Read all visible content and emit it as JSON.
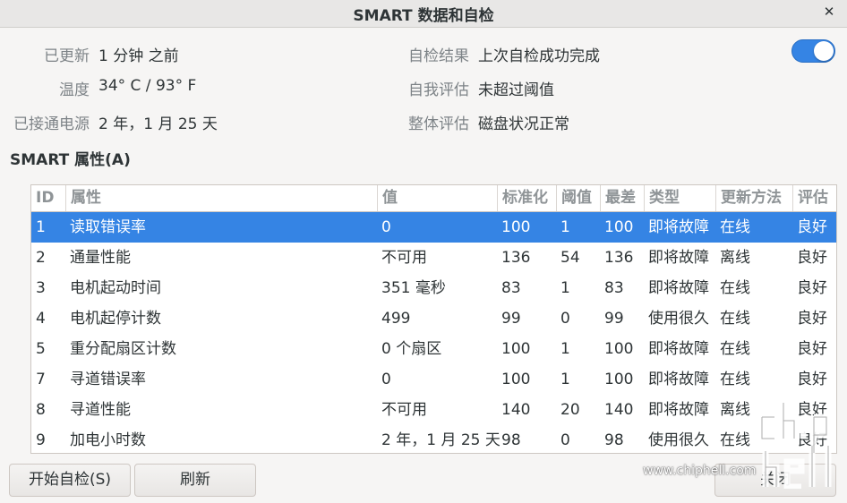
{
  "window": {
    "title": "SMART 数据和自检",
    "close_icon": "close-icon"
  },
  "info": {
    "updated_label": "已更新",
    "updated_value": "1 分钟 之前",
    "temp_label": "温度",
    "temp_value": "34° C / 93° F",
    "power_label": "已接通电源",
    "power_value": "2 年，1 月 25 天",
    "selftest_label": "自检结果",
    "selftest_value": "上次自检成功完成",
    "selfassess_label": "自我评估",
    "selfassess_value": "未超过阈值",
    "overall_label": "整体评估",
    "overall_value": "磁盘状况正常"
  },
  "toggle": {
    "state": "on",
    "accent": "#3584e4"
  },
  "attributes": {
    "section_title": "SMART 属性(A)",
    "columns": [
      "ID",
      "属性",
      "值",
      "标准化",
      "阈值",
      "最差",
      "类型",
      "更新方法",
      "评估"
    ],
    "rows": [
      [
        "1",
        "读取错误率",
        "0",
        "100",
        "1",
        "100",
        "即将故障",
        "在线",
        "良好"
      ],
      [
        "2",
        "通量性能",
        "不可用",
        "136",
        "54",
        "136",
        "即将故障",
        "离线",
        "良好"
      ],
      [
        "3",
        "电机起动时间",
        "351 毫秒",
        "83",
        "1",
        "83",
        "即将故障",
        "在线",
        "良好"
      ],
      [
        "4",
        "电机起停计数",
        "499",
        "99",
        "0",
        "99",
        "使用很久",
        "在线",
        "良好"
      ],
      [
        "5",
        "重分配扇区计数",
        "0 个扇区",
        "100",
        "1",
        "100",
        "即将故障",
        "在线",
        "良好"
      ],
      [
        "7",
        "寻道错误率",
        "0",
        "100",
        "1",
        "100",
        "即将故障",
        "在线",
        "良好"
      ],
      [
        "8",
        "寻道性能",
        "不可用",
        "140",
        "20",
        "140",
        "即将故障",
        "离线",
        "良好"
      ],
      [
        "9",
        "加电小时数",
        "2 年，1 月 25 天",
        "98",
        "0",
        "98",
        "使用很久",
        "在线",
        "良好"
      ]
    ],
    "selected_row": 0
  },
  "buttons": {
    "start_selftest": "开始自检(S)",
    "refresh": "刷新",
    "close": "关闭"
  },
  "watermark": {
    "site": "www.chiphell.com",
    "logo": "chip hell"
  }
}
